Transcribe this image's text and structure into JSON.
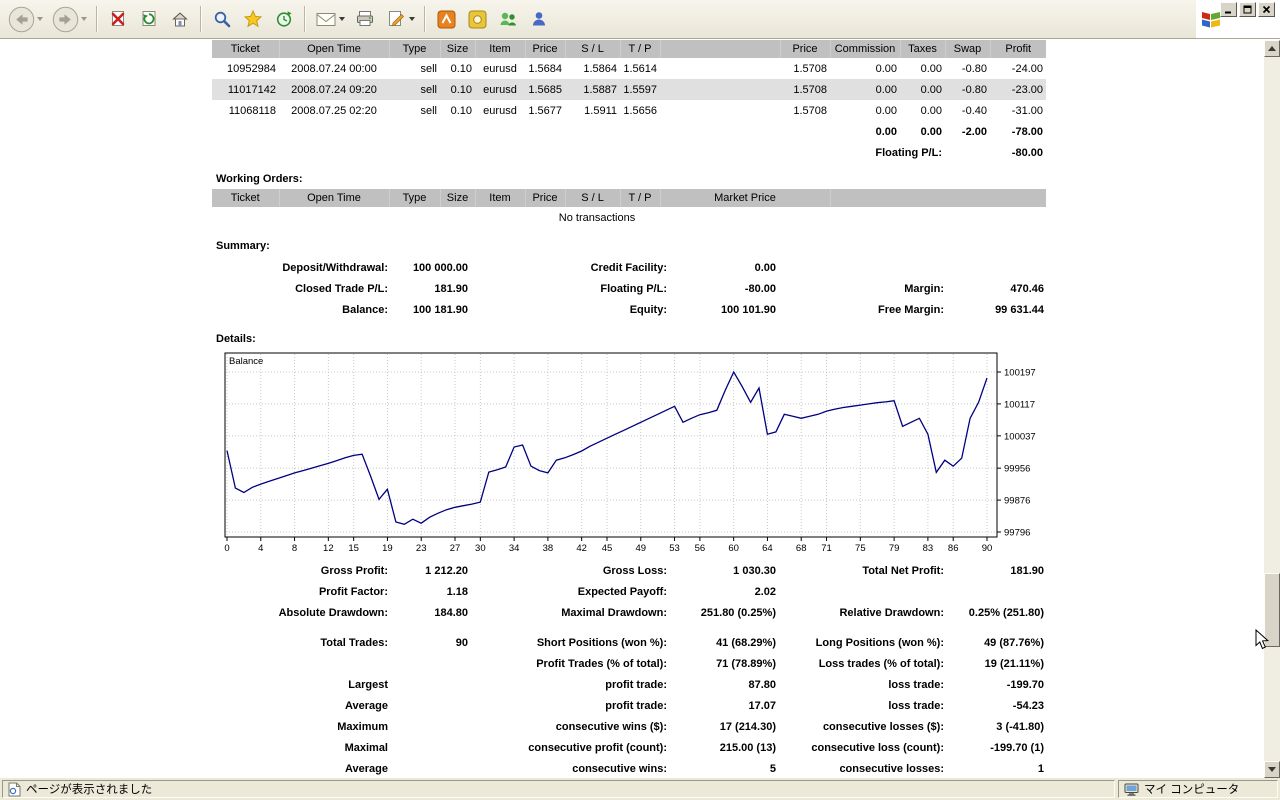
{
  "browser": {
    "toolbar_icons": [
      "back",
      "forward",
      "stop",
      "refresh",
      "home",
      "search",
      "favorites",
      "history",
      "mail",
      "print",
      "edit",
      "app-orange",
      "app-gold",
      "messenger",
      "app-blue"
    ],
    "window_controls": [
      "minimize",
      "maximize",
      "close"
    ],
    "status": {
      "left_text": "ページが表示されました",
      "right_text": "マイ コンピュータ"
    }
  },
  "open_trades": {
    "headers": [
      "Ticket",
      "Open Time",
      "Type",
      "Size",
      "Item",
      "Price",
      "S / L",
      "T / P",
      "",
      "Price",
      "Commission",
      "Taxes",
      "Swap",
      "Profit"
    ],
    "rows": [
      [
        "10952984",
        "2008.07.24 00:00",
        "sell",
        "0.10",
        "eurusd",
        "1.5684",
        "1.5864",
        "1.5614",
        "",
        "1.5708",
        "0.00",
        "0.00",
        "-0.80",
        "-24.00"
      ],
      [
        "11017142",
        "2008.07.24 09:20",
        "sell",
        "0.10",
        "eurusd",
        "1.5685",
        "1.5887",
        "1.5597",
        "",
        "1.5708",
        "0.00",
        "0.00",
        "-0.80",
        "-23.00"
      ],
      [
        "11068118",
        "2008.07.25 02:20",
        "sell",
        "0.10",
        "eurusd",
        "1.5677",
        "1.5911",
        "1.5656",
        "",
        "1.5708",
        "0.00",
        "0.00",
        "-0.40",
        "-31.00"
      ]
    ],
    "totals": [
      "0.00",
      "0.00",
      "-2.00",
      "-78.00"
    ],
    "floating_label": "Floating P/L:",
    "floating_value": "-80.00"
  },
  "working_orders": {
    "title": "Working Orders:",
    "headers": [
      "Ticket",
      "Open Time",
      "Type",
      "Size",
      "Item",
      "Price",
      "S / L",
      "T / P",
      "Market Price",
      ""
    ],
    "empty_text": "No transactions"
  },
  "summary": {
    "title": "Summary:",
    "rows": [
      [
        "Deposit/Withdrawal:",
        "100 000.00",
        "Credit Facility:",
        "0.00",
        "",
        ""
      ],
      [
        "Closed Trade P/L:",
        "181.90",
        "Floating P/L:",
        "-80.00",
        "Margin:",
        "470.46"
      ],
      [
        "Balance:",
        "100 181.90",
        "Equity:",
        "100 101.90",
        "Free Margin:",
        "99 631.44"
      ]
    ]
  },
  "details": {
    "title": "Details:",
    "stats": [
      {
        "cells": [
          "Gross Profit:",
          "1 212.20",
          "Gross Loss:",
          "1 030.30",
          "Total Net Profit:",
          "181.90"
        ]
      },
      {
        "cells": [
          "Profit Factor:",
          "1.18",
          "Expected Payoff:",
          "2.02",
          "",
          ""
        ]
      },
      {
        "cells": [
          "Absolute Drawdown:",
          "184.80",
          "Maximal Drawdown:",
          "251.80 (0.25%)",
          "Relative Drawdown:",
          "0.25% (251.80)"
        ]
      },
      {
        "cells": [
          "Total Trades:",
          "90",
          "Short Positions (won %):",
          "41 (68.29%)",
          "Long Positions (won %):",
          "49 (87.76%)"
        ],
        "gap_before": true
      },
      {
        "cells": [
          "",
          "",
          "Profit Trades (% of total):",
          "71 (78.89%)",
          "Loss trades (% of total):",
          "19 (21.11%)"
        ]
      },
      {
        "cells": [
          "Largest",
          "",
          "profit trade:",
          "87.80",
          "loss trade:",
          "-199.70"
        ]
      },
      {
        "cells": [
          "Average",
          "",
          "profit trade:",
          "17.07",
          "loss trade:",
          "-54.23"
        ]
      },
      {
        "cells": [
          "Maximum",
          "",
          "consecutive wins ($):",
          "17 (214.30)",
          "consecutive losses ($):",
          "3 (-41.80)"
        ]
      },
      {
        "cells": [
          "Maximal",
          "",
          "consecutive profit (count):",
          "215.00 (13)",
          "consecutive loss (count):",
          "-199.70 (1)"
        ]
      },
      {
        "cells": [
          "Average",
          "",
          "consecutive wins:",
          "5",
          "consecutive losses:",
          "1"
        ]
      }
    ]
  },
  "chart_data": {
    "type": "line",
    "title": "Balance",
    "legend_label": "Balance",
    "x_range": [
      0,
      90
    ],
    "xticks": [
      0,
      4,
      8,
      12,
      15,
      19,
      23,
      27,
      30,
      34,
      38,
      42,
      45,
      49,
      53,
      56,
      60,
      64,
      68,
      71,
      75,
      79,
      83,
      86,
      90
    ],
    "yticks": [
      100197,
      100117,
      100037,
      99956,
      99876,
      99796
    ],
    "line_color": "#000080",
    "grid": true,
    "series": [
      {
        "name": "Balance",
        "values": [
          100000,
          99906,
          99895,
          99908,
          99916,
          99923,
          99930,
          99937,
          99944,
          99950,
          99956,
          99962,
          99968,
          99975,
          99982,
          99988,
          99991,
          99936,
          99878,
          99903,
          99821,
          99815.2,
          99828,
          99818,
          99833,
          99843,
          99852,
          99858,
          99862,
          99866,
          99871,
          99946,
          99952,
          99959,
          100009,
          100014,
          99961,
          99950,
          99944,
          99976,
          99982,
          99990,
          99999,
          100011,
          100021,
          100031,
          100041,
          100051,
          100061,
          100071,
          100081,
          100091,
          100101,
          100111,
          100071,
          100081,
          100090,
          100095,
          100101,
          100151,
          100197,
          100161,
          100121,
          100157,
          100041,
          100047,
          100091,
          100086,
          100081,
          100086,
          100091,
          100099,
          100104,
          100108,
          100111,
          100114,
          100117,
          100120,
          100122,
          100125,
          100061,
          100071,
          100081,
          100041,
          99945.4,
          99976,
          99961,
          99981,
          100081,
          100121,
          100181.9
        ]
      }
    ]
  }
}
